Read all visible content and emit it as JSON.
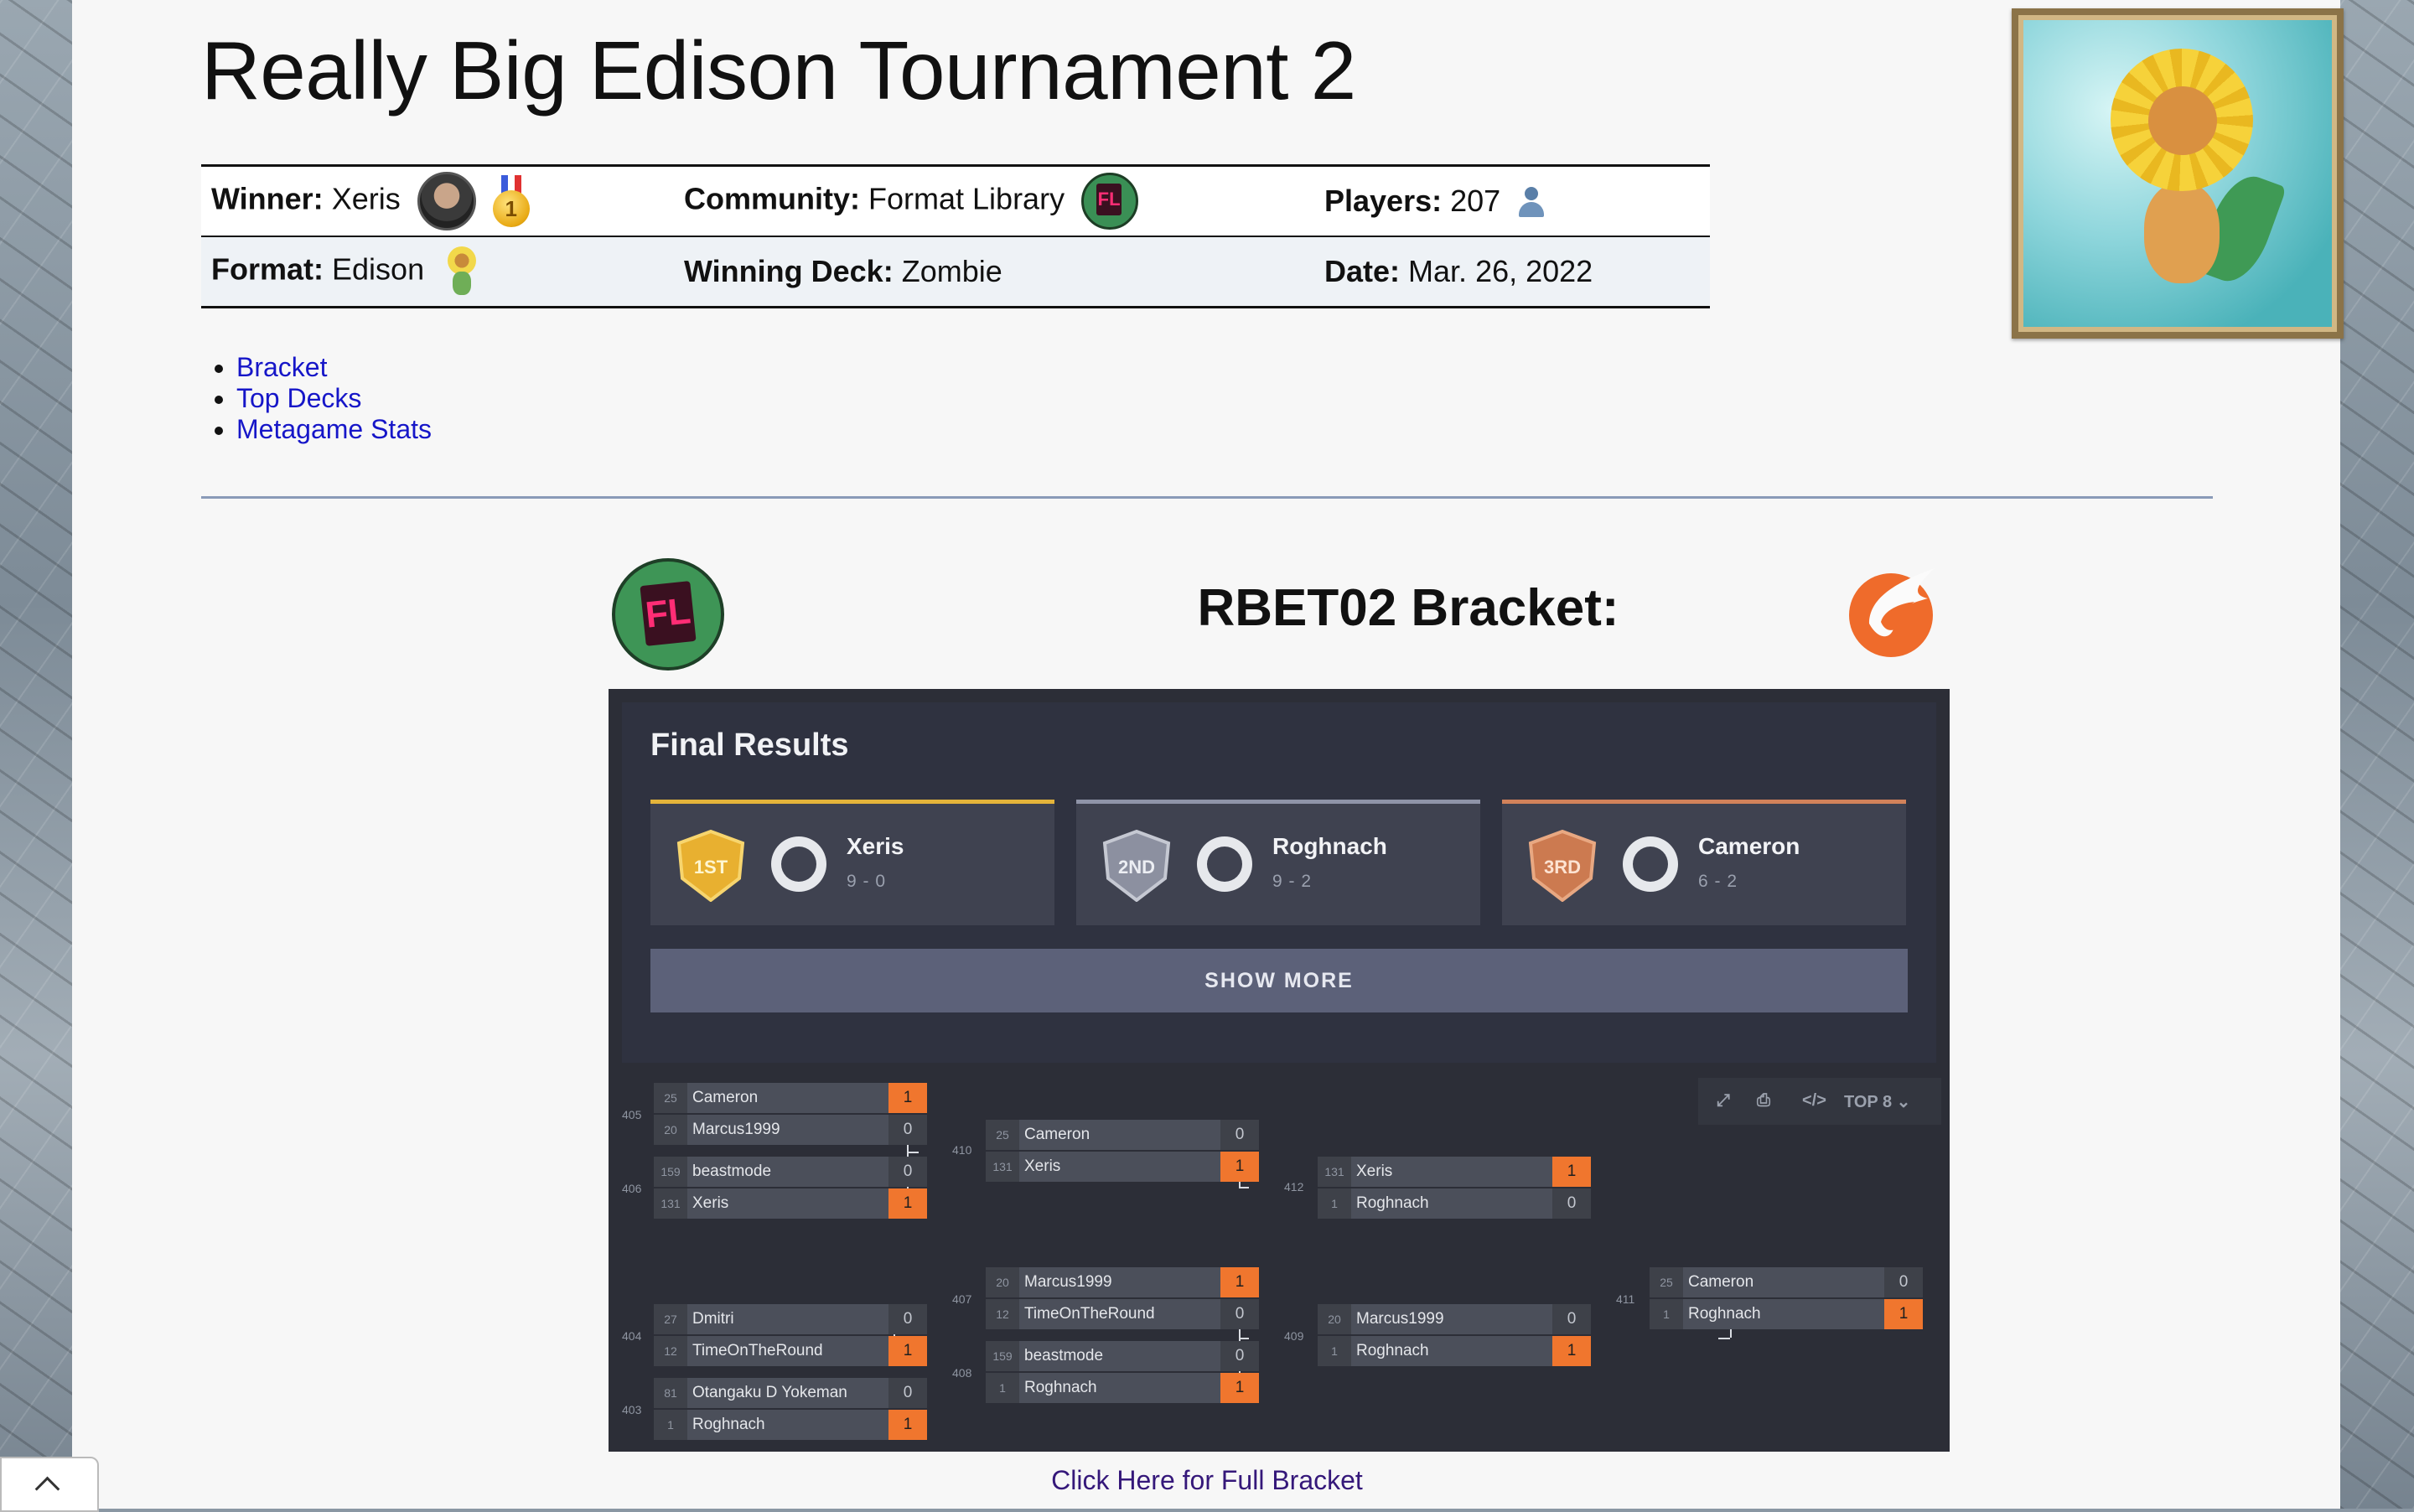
{
  "title": "Really Big Edison Tournament 2",
  "info": {
    "winner_label": "Winner:",
    "winner": "Xeris",
    "community_label": "Community:",
    "community": "Format Library",
    "players_label": "Players:",
    "players": "207",
    "format_label": "Format:",
    "format": "Edison",
    "deck_label": "Winning Deck:",
    "deck": "Zombie",
    "date_label": "Date:",
    "date": "Mar. 26, 2022",
    "medal_text": "1",
    "fl_text": "FL"
  },
  "nav": [
    "Bracket",
    "Top Decks",
    "Metagame Stats"
  ],
  "bracket_heading": "RBET02 Bracket:",
  "final_results": {
    "title": "Final Results",
    "podium": [
      {
        "place": "1ST",
        "name": "Xeris",
        "record": "9 - 0",
        "color": "#e4b43a"
      },
      {
        "place": "2ND",
        "name": "Roghnach",
        "record": "9 - 2",
        "color": "#8f94a8"
      },
      {
        "place": "3RD",
        "name": "Cameron",
        "record": "6 - 2",
        "color": "#d2825a"
      }
    ],
    "show_more": "SHOW MORE"
  },
  "toolbar": {
    "view": "TOP 8"
  },
  "matches": [
    {
      "id": "405",
      "p": [
        {
          "seed": "25",
          "name": "Cameron",
          "score": "1",
          "win": true
        },
        {
          "seed": "20",
          "name": "Marcus1999",
          "score": "0",
          "win": false
        }
      ]
    },
    {
      "id": "406",
      "p": [
        {
          "seed": "159",
          "name": "beastmode",
          "score": "0",
          "win": false
        },
        {
          "seed": "131",
          "name": "Xeris",
          "score": "1",
          "win": true
        }
      ]
    },
    {
      "id": "410",
      "p": [
        {
          "seed": "25",
          "name": "Cameron",
          "score": "0",
          "win": false
        },
        {
          "seed": "131",
          "name": "Xeris",
          "score": "1",
          "win": true
        }
      ]
    },
    {
      "id": "412",
      "p": [
        {
          "seed": "131",
          "name": "Xeris",
          "score": "1",
          "win": true
        },
        {
          "seed": "1",
          "name": "Roghnach",
          "score": "0",
          "win": false
        }
      ]
    },
    {
      "id": "404",
      "p": [
        {
          "seed": "27",
          "name": "Dmitri",
          "score": "0",
          "win": false
        },
        {
          "seed": "12",
          "name": "TimeOnTheRound",
          "score": "1",
          "win": true
        }
      ]
    },
    {
      "id": "403",
      "p": [
        {
          "seed": "81",
          "name": "Otangaku D Yokeman",
          "score": "0",
          "win": false
        },
        {
          "seed": "1",
          "name": "Roghnach",
          "score": "1",
          "win": true
        }
      ]
    },
    {
      "id": "407",
      "p": [
        {
          "seed": "20",
          "name": "Marcus1999",
          "score": "1",
          "win": true
        },
        {
          "seed": "12",
          "name": "TimeOnTheRound",
          "score": "0",
          "win": false
        }
      ]
    },
    {
      "id": "408",
      "p": [
        {
          "seed": "159",
          "name": "beastmode",
          "score": "0",
          "win": false
        },
        {
          "seed": "1",
          "name": "Roghnach",
          "score": "1",
          "win": true
        }
      ]
    },
    {
      "id": "409",
      "p": [
        {
          "seed": "20",
          "name": "Marcus1999",
          "score": "0",
          "win": false
        },
        {
          "seed": "1",
          "name": "Roghnach",
          "score": "1",
          "win": true
        }
      ]
    },
    {
      "id": "411",
      "p": [
        {
          "seed": "25",
          "name": "Cameron",
          "score": "0",
          "win": false
        },
        {
          "seed": "1",
          "name": "Roghnach",
          "score": "1",
          "win": true
        }
      ]
    }
  ],
  "full_bracket_link": "Click Here for Full Bracket"
}
